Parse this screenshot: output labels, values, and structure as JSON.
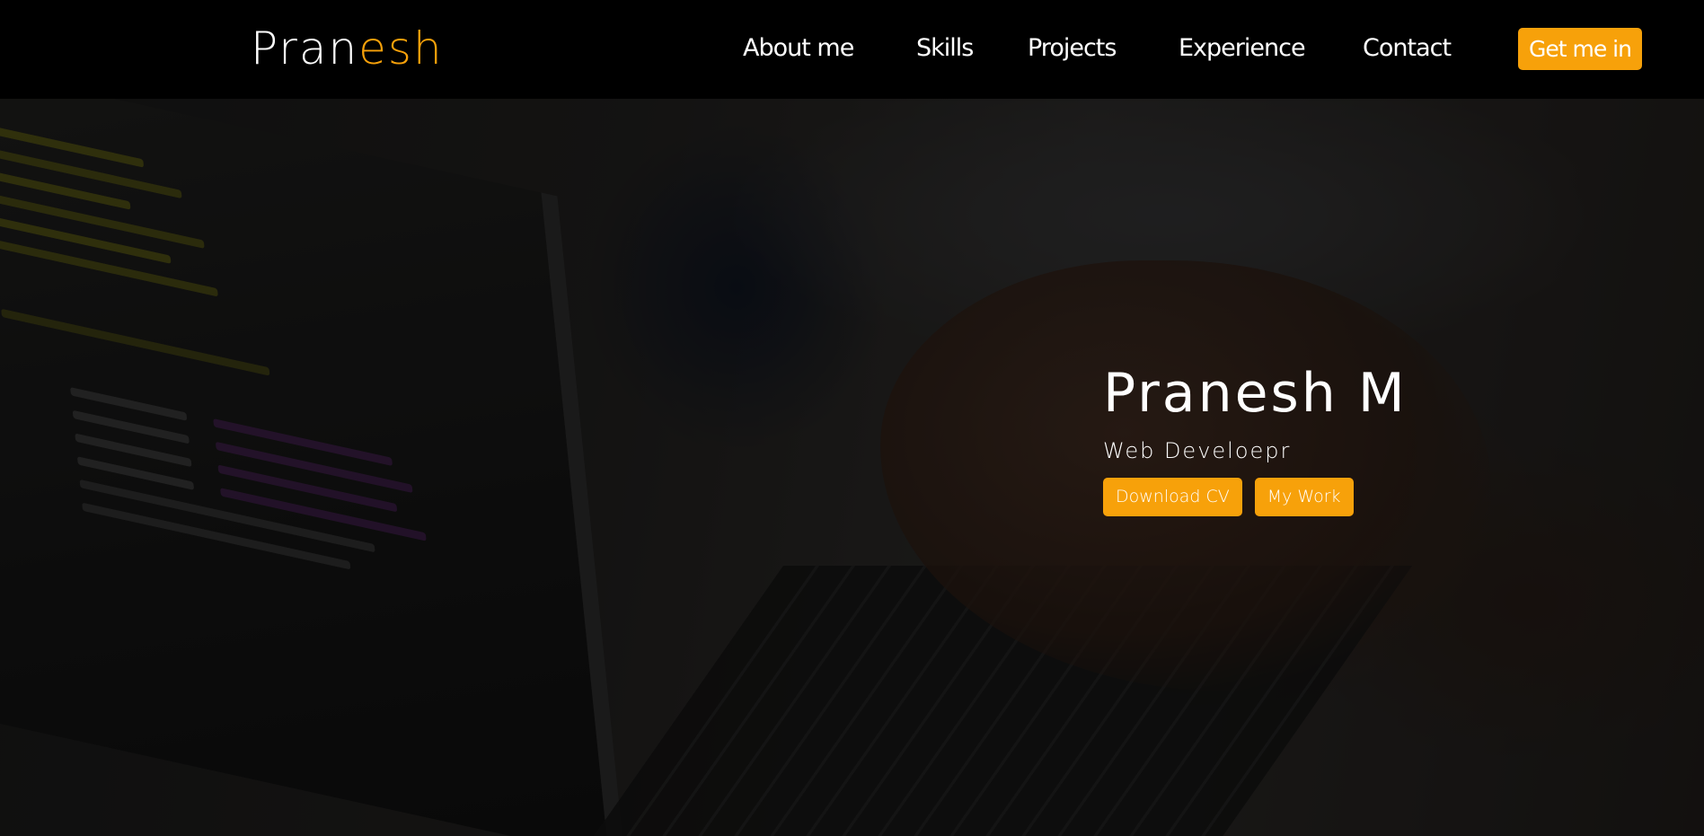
{
  "brand": {
    "part1": "Pran",
    "part2": "esh",
    "accent_color": "#f7a10a"
  },
  "nav": {
    "items": [
      {
        "label": "About me"
      },
      {
        "label": "Skills"
      },
      {
        "label": "Projects"
      },
      {
        "label": "Experience"
      },
      {
        "label": "Contact"
      }
    ],
    "cta_label": "Get me in"
  },
  "hero": {
    "title": "Pranesh M",
    "subtitle": "Web Develoepr",
    "buttons": [
      {
        "label": "Download CV"
      },
      {
        "label": "My Work"
      }
    ],
    "background_image": "laptop-coding-photo"
  }
}
